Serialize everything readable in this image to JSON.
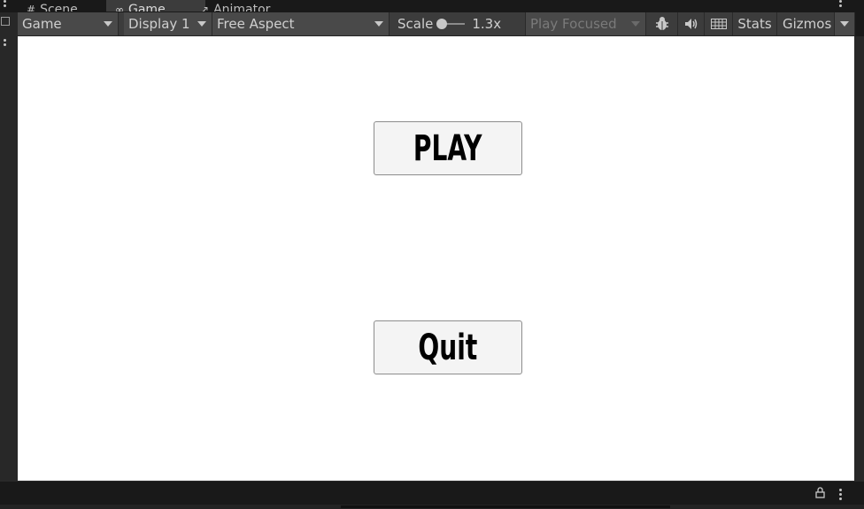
{
  "tabs": [
    {
      "icon": "#",
      "label": "Scene",
      "active": false
    },
    {
      "icon": "∞",
      "label": "Game",
      "active": true
    },
    {
      "icon": "↗",
      "label": "Animator",
      "active": false
    }
  ],
  "toolbar": {
    "view_mode": "Game",
    "display": "Display 1",
    "aspect": "Free Aspect",
    "scale_label": "Scale",
    "scale_value": "1.3x",
    "play_mode": "Play Focused",
    "stats_label": "Stats",
    "gizmos_label": "Gizmos"
  },
  "game": {
    "play_label": "PLAY",
    "quit_label": "Quit"
  },
  "colors": {
    "editor_bg": "#191919",
    "toolbar_bg": "#3c3c3c",
    "game_bg": "#ffffff",
    "button_bg": "#f4f4f4"
  }
}
